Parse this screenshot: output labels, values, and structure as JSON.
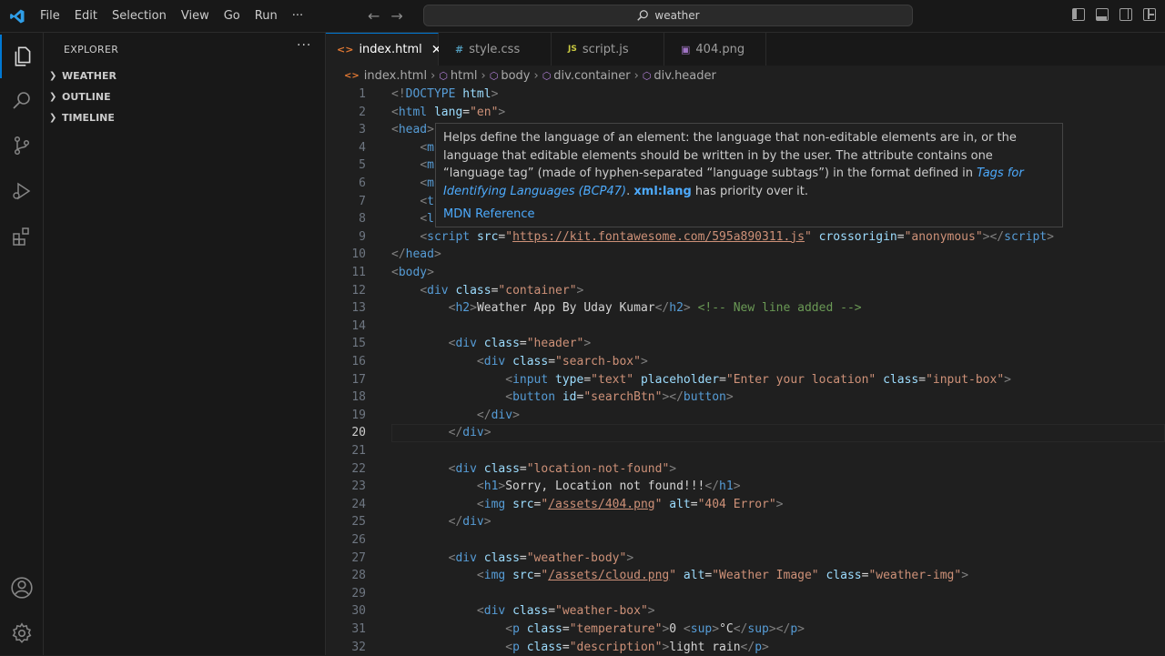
{
  "menu": [
    "File",
    "Edit",
    "Selection",
    "View",
    "Go",
    "Run",
    "···"
  ],
  "search": {
    "text": "weather"
  },
  "sidebar": {
    "title": "EXPLORER",
    "more": "···",
    "sections": [
      "WEATHER",
      "OUTLINE",
      "TIMELINE"
    ]
  },
  "tabs": [
    {
      "icon": "<>",
      "label": "index.html",
      "active": true,
      "close": "✕"
    },
    {
      "icon": "#",
      "label": "style.css"
    },
    {
      "icon": "JS",
      "label": "script.js"
    },
    {
      "icon": "img",
      "label": "404.png"
    }
  ],
  "breadcrumb": [
    "index.html",
    "html",
    "body",
    "div.container",
    "div.header"
  ],
  "editor": {
    "current_line": 20,
    "line_numbers": [
      1,
      2,
      3,
      4,
      5,
      6,
      7,
      8,
      9,
      10,
      11,
      12,
      13,
      14,
      15,
      16,
      17,
      18,
      19,
      20,
      21,
      22,
      23,
      24,
      25,
      26,
      27,
      28,
      29,
      30,
      31,
      32
    ]
  },
  "hover": {
    "description": "Helps define the language of an element: the language that non-editable elements are in, or the language that editable elements should be written in by the user. The attribute contains one “language tag” (made of hyphen-separated “language subtags”) in the format defined in ",
    "link": "Tags for Identifying Languages (BCP47)",
    "after_link": ". ",
    "code": "xml:lang",
    "after_code": " has priority over it.",
    "mdn": "MDN Reference"
  },
  "colors": {
    "accent": "#0078d4",
    "tag": "#569cd6",
    "attribute": "#9cdcfe",
    "string": "#ce9178",
    "comment": "#6a9955"
  },
  "code_lines": [
    [
      [
        "p",
        "<!"
      ],
      [
        "t",
        "DOCTYPE"
      ],
      [
        "x",
        " "
      ],
      [
        "a",
        "html"
      ],
      [
        "p",
        ">"
      ]
    ],
    [
      [
        "p",
        "<"
      ],
      [
        "t",
        "html"
      ],
      [
        "x",
        " "
      ],
      [
        "a",
        "lang"
      ],
      [
        "x",
        "="
      ],
      [
        "s",
        "\"en\""
      ],
      [
        "p",
        ">"
      ]
    ],
    [
      [
        "p",
        "<"
      ],
      [
        "t",
        "head"
      ],
      [
        "p",
        ">"
      ]
    ],
    [
      [
        "x",
        "    "
      ],
      [
        "p",
        "<"
      ],
      [
        "t",
        "m"
      ]
    ],
    [
      [
        "x",
        "    "
      ],
      [
        "p",
        "<"
      ],
      [
        "t",
        "m"
      ]
    ],
    [
      [
        "x",
        "    "
      ],
      [
        "p",
        "<"
      ],
      [
        "t",
        "m"
      ]
    ],
    [
      [
        "x",
        "    "
      ],
      [
        "p",
        "<"
      ],
      [
        "t",
        "t"
      ]
    ],
    [
      [
        "x",
        "    "
      ],
      [
        "p",
        "<"
      ],
      [
        "t",
        "l"
      ]
    ],
    [
      [
        "x",
        "    "
      ],
      [
        "p",
        "<"
      ],
      [
        "t",
        "script"
      ],
      [
        "x",
        " "
      ],
      [
        "a",
        "src"
      ],
      [
        "x",
        "="
      ],
      [
        "s",
        "\""
      ],
      [
        "u",
        "https://kit.fontawesome.com/595a890311.js"
      ],
      [
        "s",
        "\""
      ],
      [
        "x",
        " "
      ],
      [
        "a",
        "crossorigin"
      ],
      [
        "x",
        "="
      ],
      [
        "s",
        "\"anonymous\""
      ],
      [
        "p",
        "></"
      ],
      [
        "t",
        "script"
      ],
      [
        "p",
        ">"
      ]
    ],
    [
      [
        "p",
        "</"
      ],
      [
        "t",
        "head"
      ],
      [
        "p",
        ">"
      ]
    ],
    [
      [
        "p",
        "<"
      ],
      [
        "t",
        "body"
      ],
      [
        "p",
        ">"
      ]
    ],
    [
      [
        "x",
        "    "
      ],
      [
        "p",
        "<"
      ],
      [
        "t",
        "div"
      ],
      [
        "x",
        " "
      ],
      [
        "a",
        "class"
      ],
      [
        "x",
        "="
      ],
      [
        "s",
        "\"container\""
      ],
      [
        "p",
        ">"
      ]
    ],
    [
      [
        "x",
        "        "
      ],
      [
        "p",
        "<"
      ],
      [
        "t",
        "h2"
      ],
      [
        "p",
        ">"
      ],
      [
        "x",
        "Weather App By Uday Kumar"
      ],
      [
        "p",
        "</"
      ],
      [
        "t",
        "h2"
      ],
      [
        "p",
        ">"
      ],
      [
        "x",
        " "
      ],
      [
        "c",
        "<!-- New line added -->"
      ]
    ],
    [
      [
        "x",
        ""
      ]
    ],
    [
      [
        "x",
        "        "
      ],
      [
        "p",
        "<"
      ],
      [
        "t",
        "div"
      ],
      [
        "x",
        " "
      ],
      [
        "a",
        "class"
      ],
      [
        "x",
        "="
      ],
      [
        "s",
        "\"header\""
      ],
      [
        "p",
        ">"
      ]
    ],
    [
      [
        "x",
        "            "
      ],
      [
        "p",
        "<"
      ],
      [
        "t",
        "div"
      ],
      [
        "x",
        " "
      ],
      [
        "a",
        "class"
      ],
      [
        "x",
        "="
      ],
      [
        "s",
        "\"search-box\""
      ],
      [
        "p",
        ">"
      ]
    ],
    [
      [
        "x",
        "                "
      ],
      [
        "p",
        "<"
      ],
      [
        "t",
        "input"
      ],
      [
        "x",
        " "
      ],
      [
        "a",
        "type"
      ],
      [
        "x",
        "="
      ],
      [
        "s",
        "\"text\""
      ],
      [
        "x",
        " "
      ],
      [
        "a",
        "placeholder"
      ],
      [
        "x",
        "="
      ],
      [
        "s",
        "\"Enter your location\""
      ],
      [
        "x",
        " "
      ],
      [
        "a",
        "class"
      ],
      [
        "x",
        "="
      ],
      [
        "s",
        "\"input-box\""
      ],
      [
        "p",
        ">"
      ]
    ],
    [
      [
        "x",
        "                "
      ],
      [
        "p",
        "<"
      ],
      [
        "t",
        "button"
      ],
      [
        "x",
        " "
      ],
      [
        "a",
        "id"
      ],
      [
        "x",
        "="
      ],
      [
        "s",
        "\"searchBtn\""
      ],
      [
        "p",
        "></"
      ],
      [
        "t",
        "button"
      ],
      [
        "p",
        ">"
      ]
    ],
    [
      [
        "x",
        "            "
      ],
      [
        "p",
        "</"
      ],
      [
        "t",
        "div"
      ],
      [
        "p",
        ">"
      ]
    ],
    [
      [
        "x",
        "        "
      ],
      [
        "p",
        "</"
      ],
      [
        "t",
        "div"
      ],
      [
        "p",
        ">"
      ]
    ],
    [
      [
        "x",
        ""
      ]
    ],
    [
      [
        "x",
        "        "
      ],
      [
        "p",
        "<"
      ],
      [
        "t",
        "div"
      ],
      [
        "x",
        " "
      ],
      [
        "a",
        "class"
      ],
      [
        "x",
        "="
      ],
      [
        "s",
        "\"location-not-found\""
      ],
      [
        "p",
        ">"
      ]
    ],
    [
      [
        "x",
        "            "
      ],
      [
        "p",
        "<"
      ],
      [
        "t",
        "h1"
      ],
      [
        "p",
        ">"
      ],
      [
        "x",
        "Sorry, Location not found!!!"
      ],
      [
        "p",
        "</"
      ],
      [
        "t",
        "h1"
      ],
      [
        "p",
        ">"
      ]
    ],
    [
      [
        "x",
        "            "
      ],
      [
        "p",
        "<"
      ],
      [
        "t",
        "img"
      ],
      [
        "x",
        " "
      ],
      [
        "a",
        "src"
      ],
      [
        "x",
        "="
      ],
      [
        "s",
        "\""
      ],
      [
        "u",
        "/assets/404.png"
      ],
      [
        "s",
        "\""
      ],
      [
        "x",
        " "
      ],
      [
        "a",
        "alt"
      ],
      [
        "x",
        "="
      ],
      [
        "s",
        "\"404 Error\""
      ],
      [
        "p",
        ">"
      ]
    ],
    [
      [
        "x",
        "        "
      ],
      [
        "p",
        "</"
      ],
      [
        "t",
        "div"
      ],
      [
        "p",
        ">"
      ]
    ],
    [
      [
        "x",
        ""
      ]
    ],
    [
      [
        "x",
        "        "
      ],
      [
        "p",
        "<"
      ],
      [
        "t",
        "div"
      ],
      [
        "x",
        " "
      ],
      [
        "a",
        "class"
      ],
      [
        "x",
        "="
      ],
      [
        "s",
        "\"weather-body\""
      ],
      [
        "p",
        ">"
      ]
    ],
    [
      [
        "x",
        "            "
      ],
      [
        "p",
        "<"
      ],
      [
        "t",
        "img"
      ],
      [
        "x",
        " "
      ],
      [
        "a",
        "src"
      ],
      [
        "x",
        "="
      ],
      [
        "s",
        "\""
      ],
      [
        "u",
        "/assets/cloud.png"
      ],
      [
        "s",
        "\""
      ],
      [
        "x",
        " "
      ],
      [
        "a",
        "alt"
      ],
      [
        "x",
        "="
      ],
      [
        "s",
        "\"Weather Image\""
      ],
      [
        "x",
        " "
      ],
      [
        "a",
        "class"
      ],
      [
        "x",
        "="
      ],
      [
        "s",
        "\"weather-img\""
      ],
      [
        "p",
        ">"
      ]
    ],
    [
      [
        "x",
        ""
      ]
    ],
    [
      [
        "x",
        "            "
      ],
      [
        "p",
        "<"
      ],
      [
        "t",
        "div"
      ],
      [
        "x",
        " "
      ],
      [
        "a",
        "class"
      ],
      [
        "x",
        "="
      ],
      [
        "s",
        "\"weather-box\""
      ],
      [
        "p",
        ">"
      ]
    ],
    [
      [
        "x",
        "                "
      ],
      [
        "p",
        "<"
      ],
      [
        "t",
        "p"
      ],
      [
        "x",
        " "
      ],
      [
        "a",
        "class"
      ],
      [
        "x",
        "="
      ],
      [
        "s",
        "\"temperature\""
      ],
      [
        "p",
        ">"
      ],
      [
        "x",
        "0 "
      ],
      [
        "p",
        "<"
      ],
      [
        "t",
        "sup"
      ],
      [
        "p",
        ">"
      ],
      [
        "x",
        "°C"
      ],
      [
        "p",
        "</"
      ],
      [
        "t",
        "sup"
      ],
      [
        "p",
        "></"
      ],
      [
        "t",
        "p"
      ],
      [
        "p",
        ">"
      ]
    ],
    [
      [
        "x",
        "                "
      ],
      [
        "p",
        "<"
      ],
      [
        "t",
        "p"
      ],
      [
        "x",
        " "
      ],
      [
        "a",
        "class"
      ],
      [
        "x",
        "="
      ],
      [
        "s",
        "\"description\""
      ],
      [
        "p",
        ">"
      ],
      [
        "x",
        "light rain"
      ],
      [
        "p",
        "</"
      ],
      [
        "t",
        "p"
      ],
      [
        "p",
        ">"
      ]
    ]
  ]
}
